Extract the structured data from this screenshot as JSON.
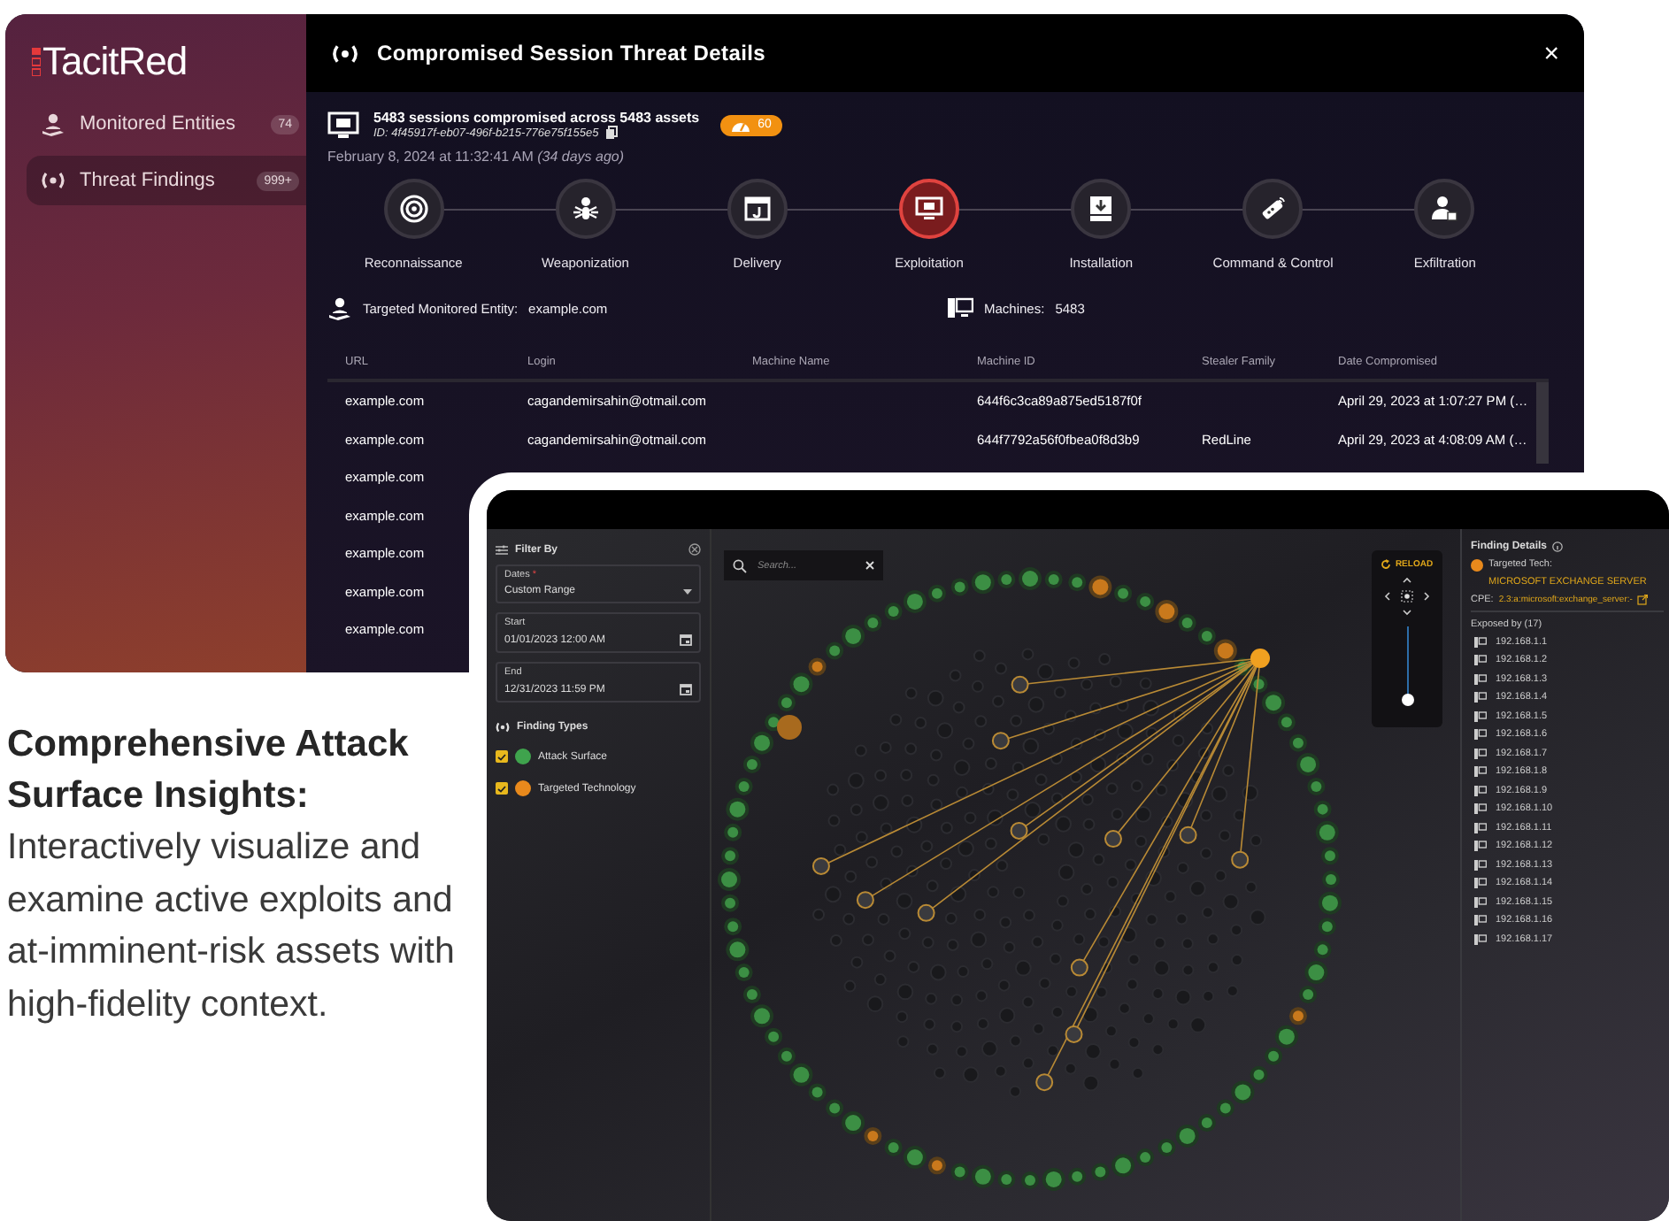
{
  "brand": {
    "logo": "TacitRed"
  },
  "sidebar": {
    "items": [
      {
        "label": "Monitored Entities",
        "count": "74",
        "selected": false
      },
      {
        "label": "Threat Findings",
        "count": "999+",
        "selected": true
      }
    ]
  },
  "threat_details": {
    "title": "Compromised Session Threat Details",
    "close": "×",
    "summary": "5483 sessions compromised across 5483 assets",
    "id": "ID: 4f45917f-eb07-496f-b215-776e75f155e5",
    "score": "60",
    "timestamp": "February 8, 2024 at 11:32:41 AM *(34 days ago)*",
    "stages": [
      {
        "label": "Reconnaissance",
        "selected": false
      },
      {
        "label": "Weaponization",
        "selected": false
      },
      {
        "label": "Delivery",
        "selected": false
      },
      {
        "label": "Exploitation",
        "selected": true
      },
      {
        "label": "Installation",
        "selected": false
      },
      {
        "label": "Command & Control",
        "selected": false
      },
      {
        "label": "Exfiltration",
        "selected": false
      }
    ],
    "entity_label": "Targeted Monitored Entity:",
    "entity": "example.com",
    "machines_label": "Machines:",
    "machines": "5483",
    "table": {
      "columns": [
        "URL",
        "Login",
        "Machine Name",
        "Machine ID",
        "Stealer Family",
        "Date Compromised"
      ],
      "rows": [
        [
          "example.com",
          "cagandemirsahin@otmail.com",
          "",
          "644f6c3ca89a875ed5187f0f",
          "",
          "April 29, 2023 at 1:07:27 PM (…"
        ],
        [
          "example.com",
          "cagandemirsahin@otmail.com",
          "",
          "644f7792a56f0fbea0f8d3b9",
          "RedLine",
          "April 29, 2023 at 4:08:09 AM (…"
        ],
        [
          "example.com"
        ],
        [
          "example.com"
        ],
        [
          "example.com"
        ],
        [
          "example.com"
        ],
        [
          "example.com"
        ]
      ]
    }
  },
  "attack_surface": {
    "filter": {
      "title": "Filter By",
      "dates_label": "Dates",
      "required_mark": "*",
      "dates_value": "Custom Range",
      "start_label": "Start",
      "start": "01/01/2023 12:00 AM",
      "end_label": "End",
      "end": "12/31/2023 11:59 PM",
      "types_title": "Finding Types",
      "finding_types": [
        {
          "label": "Attack Surface",
          "checked": true,
          "color": "#3fa34d"
        },
        {
          "label": "Targeted Technology",
          "checked": true,
          "color": "#e8891c"
        }
      ]
    },
    "search": {
      "placeholder": "Search..."
    },
    "controls": {
      "reload": "RELOAD"
    },
    "zoom": {
      "level": 0
    },
    "details": {
      "title": "Finding Details",
      "tech_label": "Targeted Tech:",
      "tech": "MICROSOFT EXCHANGE SERVER",
      "cpe_label": "CPE:",
      "cpe": "2.3:a:microsoft:exchange_server:-",
      "exposed_title": "Exposed by (17)",
      "exposed": [
        "192.168.1.1",
        "192.168.1.2",
        "192.168.1.3",
        "192.168.1.4",
        "192.168.1.5",
        "192.168.1.6",
        "192.168.1.7",
        "192.168.1.8",
        "192.168.1.9",
        "192.168.1.10",
        "192.168.1.11",
        "192.168.1.12",
        "192.168.1.13",
        "192.168.1.14",
        "192.168.1.15",
        "192.168.1.16",
        "192.168.1.17"
      ]
    }
  },
  "caption": {
    "heading": "Comprehensive Attack Surface Insights:",
    "body": "Interactively visualize and examine active exploits and at-imminent-risk assets with high-fidelity context."
  }
}
